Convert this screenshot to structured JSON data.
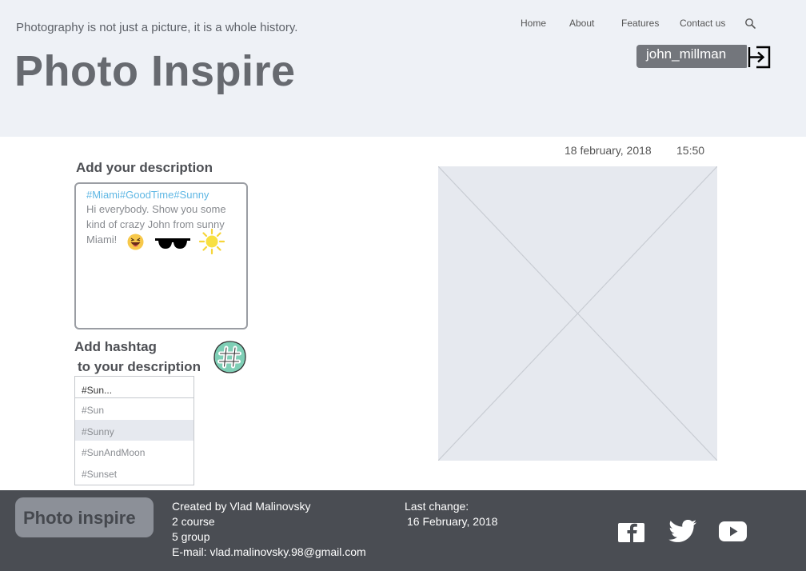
{
  "header": {
    "tagline": "Photography is not just a picture, it is a whole history.",
    "title": "Photo Inspire",
    "nav": [
      "Home",
      "About",
      "Features",
      "Contact us"
    ],
    "search_icon": "search-icon",
    "username": "john_millman",
    "logout_icon": "logout-icon"
  },
  "description": {
    "title": "Add your description",
    "tags": "#Miami#GoodTime#Sunny",
    "text": "Hi everybody. Show you some kind of crazy John from sunny Miami!",
    "emojis": [
      "laughing-emoji",
      "sunglasses-emoji",
      "sun-emoji"
    ]
  },
  "hashtag": {
    "title_line1": "Add hashtag",
    "title_line2": "to your description",
    "input_value": "#Sun...",
    "options": [
      "#Sun",
      "#Sunny",
      "#SunAndMoon",
      "#Sunset"
    ],
    "selected_index": 1
  },
  "post": {
    "date": "18 february, 2018",
    "time": "15:50"
  },
  "footer": {
    "logo": "Photo inspire",
    "created_by": "Created by Vlad Malinovsky",
    "course": "2 course",
    "group": "5 group",
    "email": "E-mail: vlad.malinovsky.98@gmail.com",
    "last_change_label": "Last change:",
    "last_change_date": "16 February, 2018",
    "social": [
      "facebook-icon",
      "twitter-icon",
      "youtube-icon"
    ]
  },
  "colors": {
    "header_bg": "#eef1f6",
    "footer_bg": "#4a4d53",
    "hashtag_blue": "#5fb7e4",
    "hashtag_badge": "#7fcfb6"
  }
}
